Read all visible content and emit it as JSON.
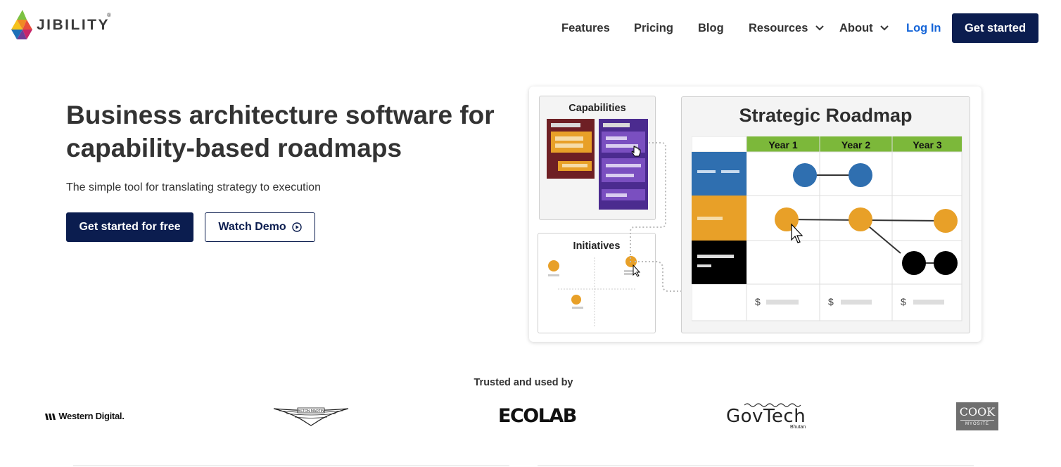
{
  "header": {
    "logo_text": "JIBILITY",
    "logo_reg": "®",
    "nav": [
      {
        "label": "Features"
      },
      {
        "label": "Pricing"
      },
      {
        "label": "Blog"
      },
      {
        "label": "Resources",
        "icon": "chevron-down-icon"
      },
      {
        "label": "About",
        "icon": "chevron-down-icon"
      }
    ],
    "login_label": "Log In",
    "cta_label": "Get started"
  },
  "hero": {
    "title": "Business architecture software for capability-based roadmaps",
    "subtitle": "The simple tool for translating strategy to execution",
    "primary_cta": "Get started for free",
    "secondary_cta": "Watch Demo",
    "secondary_cta_icon": "play-circle-icon"
  },
  "illustration": {
    "capabilities_title": "Capabilities",
    "initiatives_title": "Initiatives",
    "roadmap_title": "Strategic Roadmap",
    "years": [
      "Year 1",
      "Year 2",
      "Year 3"
    ],
    "currency_symbol": "$"
  },
  "trusted": {
    "heading": "Trusted and used by",
    "logos": [
      "Western Digital.",
      "ASTON MARTIN",
      "ECOLAB",
      "GovTech",
      "COOK"
    ],
    "govtech_sub": "Bhutan",
    "cook_sub": "MYOSITE"
  },
  "colors": {
    "navy": "#0b1d4f",
    "link_blue": "#1565d8",
    "green": "#7cb83a",
    "blue": "#2f6fb0",
    "orange": "#e8a028",
    "maroon": "#6e1f24",
    "purple": "#4b2b8f"
  }
}
